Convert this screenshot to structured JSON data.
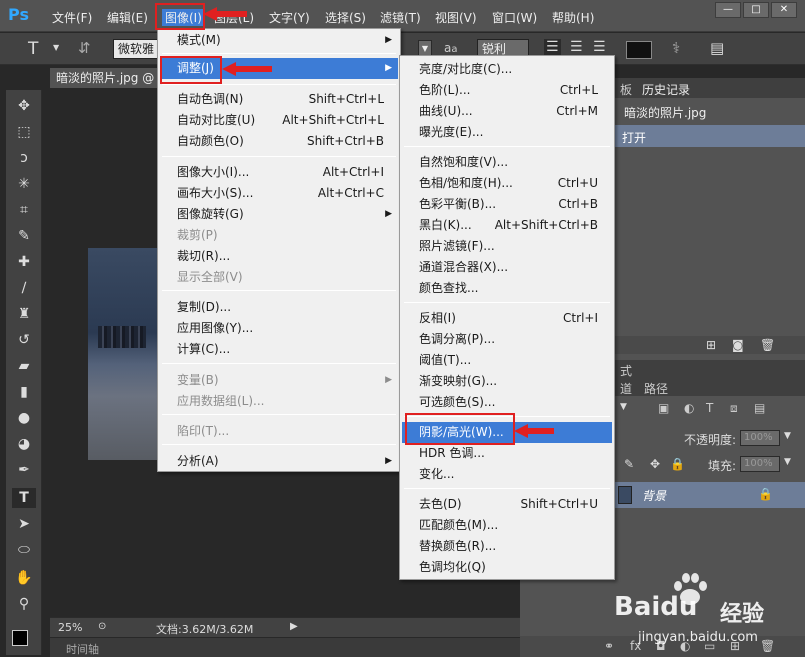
{
  "app": {
    "logo": "Ps"
  },
  "menubar": [
    "文件(F)",
    "编辑(E)",
    "图像(I)",
    "图层(L)",
    "文字(Y)",
    "选择(S)",
    "滤镜(T)",
    "视图(V)",
    "窗口(W)",
    "帮助(H)"
  ],
  "window_controls": [
    "—",
    "□",
    "✕"
  ],
  "options": {
    "font_name": "微软雅",
    "aa_label": "a",
    "aa_mode": "锐利"
  },
  "document": {
    "tab_title": "暗淡的照片.jpg @",
    "zoom": "25%",
    "doc_size": "文档:3.62M/3.62M",
    "timeline": "时间轴"
  },
  "panels": {
    "history_tabs": [
      "板",
      "历史记录"
    ],
    "history_file": "暗淡的照片.jpg",
    "history_step": "打开",
    "layers_tabs_partial": "式",
    "layers_tabs": [
      "道",
      "路径"
    ],
    "opacity_label": "不透明度:",
    "opacity_value": "100%",
    "fill_label": "填充:",
    "fill_value": "100%",
    "layer_name": "背景"
  },
  "image_menu": [
    {
      "label": "模式(M)",
      "shortcut": "",
      "submenu": true
    },
    {
      "label": "调整(J)",
      "shortcut": "",
      "submenu": true,
      "highlight": true
    },
    {
      "label": "自动色调(N)",
      "shortcut": "Shift+Ctrl+L"
    },
    {
      "label": "自动对比度(U)",
      "shortcut": "Alt+Shift+Ctrl+L"
    },
    {
      "label": "自动颜色(O)",
      "shortcut": "Shift+Ctrl+B"
    },
    {
      "label": "图像大小(I)...",
      "shortcut": "Alt+Ctrl+I"
    },
    {
      "label": "画布大小(S)...",
      "shortcut": "Alt+Ctrl+C"
    },
    {
      "label": "图像旋转(G)",
      "shortcut": "",
      "submenu": true
    },
    {
      "label": "裁剪(P)",
      "shortcut": "",
      "disabled": true
    },
    {
      "label": "裁切(R)...",
      "shortcut": ""
    },
    {
      "label": "显示全部(V)",
      "shortcut": "",
      "disabled": true
    },
    {
      "label": "复制(D)...",
      "shortcut": ""
    },
    {
      "label": "应用图像(Y)...",
      "shortcut": ""
    },
    {
      "label": "计算(C)...",
      "shortcut": ""
    },
    {
      "label": "变量(B)",
      "shortcut": "",
      "submenu": true,
      "disabled": true
    },
    {
      "label": "应用数据组(L)...",
      "shortcut": "",
      "disabled": true
    },
    {
      "label": "陷印(T)...",
      "shortcut": "",
      "disabled": true
    },
    {
      "label": "分析(A)",
      "shortcut": "",
      "submenu": true
    }
  ],
  "adjust_menu": [
    {
      "label": "亮度/对比度(C)...",
      "shortcut": ""
    },
    {
      "label": "色阶(L)...",
      "shortcut": "Ctrl+L"
    },
    {
      "label": "曲线(U)...",
      "shortcut": "Ctrl+M"
    },
    {
      "label": "曝光度(E)...",
      "shortcut": ""
    },
    {
      "label": "自然饱和度(V)...",
      "shortcut": ""
    },
    {
      "label": "色相/饱和度(H)...",
      "shortcut": "Ctrl+U"
    },
    {
      "label": "色彩平衡(B)...",
      "shortcut": "Ctrl+B"
    },
    {
      "label": "黑白(K)...",
      "shortcut": "Alt+Shift+Ctrl+B"
    },
    {
      "label": "照片滤镜(F)...",
      "shortcut": ""
    },
    {
      "label": "通道混合器(X)...",
      "shortcut": ""
    },
    {
      "label": "颜色查找...",
      "shortcut": ""
    },
    {
      "label": "反相(I)",
      "shortcut": "Ctrl+I"
    },
    {
      "label": "色调分离(P)...",
      "shortcut": ""
    },
    {
      "label": "阈值(T)...",
      "shortcut": ""
    },
    {
      "label": "渐变映射(G)...",
      "shortcut": ""
    },
    {
      "label": "可选颜色(S)...",
      "shortcut": ""
    },
    {
      "label": "阴影/高光(W)...",
      "shortcut": "",
      "highlight": true
    },
    {
      "label": "HDR 色调...",
      "shortcut": ""
    },
    {
      "label": "变化...",
      "shortcut": ""
    },
    {
      "label": "去色(D)",
      "shortcut": "Shift+Ctrl+U"
    },
    {
      "label": "匹配颜色(M)...",
      "shortcut": ""
    },
    {
      "label": "替换颜色(R)...",
      "shortcut": ""
    },
    {
      "label": "色调均化(Q)",
      "shortcut": ""
    }
  ],
  "watermark": {
    "brand": "Baidu",
    "sub": "经验",
    "url": "jingyan.baidu.com"
  }
}
